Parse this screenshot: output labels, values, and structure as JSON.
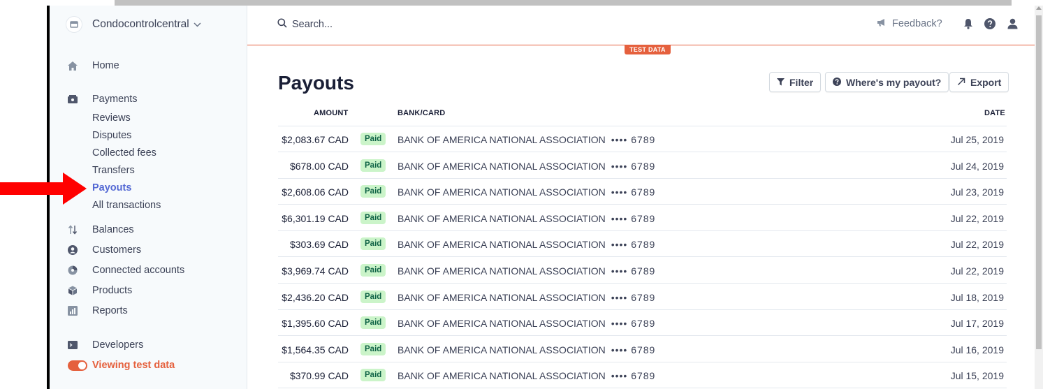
{
  "account": {
    "name": "Condocontrolcentral"
  },
  "search": {
    "placeholder": "Search..."
  },
  "topbar": {
    "feedback": "Feedback?"
  },
  "test_tag": "TEST DATA",
  "sidebar": {
    "home": "Home",
    "payments": "Payments",
    "payments_sub": [
      "Reviews",
      "Disputes",
      "Collected fees",
      "Transfers",
      "Payouts",
      "All transactions"
    ],
    "balances": "Balances",
    "customers": "Customers",
    "connected_accounts": "Connected accounts",
    "products": "Products",
    "reports": "Reports",
    "developers": "Developers",
    "viewing_test_data": "Viewing test data"
  },
  "page": {
    "title": "Payouts",
    "filter_label": "Filter",
    "wheres_payout_label": "Where's my payout?",
    "export_label": "Export"
  },
  "table": {
    "headers": {
      "amount": "AMOUNT",
      "bank": "BANK/CARD",
      "date": "DATE"
    },
    "rows": [
      {
        "amount": "$2,083.67",
        "currency": "CAD",
        "status": "Paid",
        "bank": "BANK OF AMERICA NATIONAL ASSOCIATION",
        "last4": "•••• 6789",
        "date": "Jul 25, 2019"
      },
      {
        "amount": "$678.00",
        "currency": "CAD",
        "status": "Paid",
        "bank": "BANK OF AMERICA NATIONAL ASSOCIATION",
        "last4": "•••• 6789",
        "date": "Jul 24, 2019"
      },
      {
        "amount": "$2,608.06",
        "currency": "CAD",
        "status": "Paid",
        "bank": "BANK OF AMERICA NATIONAL ASSOCIATION",
        "last4": "•••• 6789",
        "date": "Jul 23, 2019"
      },
      {
        "amount": "$6,301.19",
        "currency": "CAD",
        "status": "Paid",
        "bank": "BANK OF AMERICA NATIONAL ASSOCIATION",
        "last4": "•••• 6789",
        "date": "Jul 22, 2019"
      },
      {
        "amount": "$303.69",
        "currency": "CAD",
        "status": "Paid",
        "bank": "BANK OF AMERICA NATIONAL ASSOCIATION",
        "last4": "•••• 6789",
        "date": "Jul 22, 2019"
      },
      {
        "amount": "$3,969.74",
        "currency": "CAD",
        "status": "Paid",
        "bank": "BANK OF AMERICA NATIONAL ASSOCIATION",
        "last4": "•••• 6789",
        "date": "Jul 22, 2019"
      },
      {
        "amount": "$2,436.20",
        "currency": "CAD",
        "status": "Paid",
        "bank": "BANK OF AMERICA NATIONAL ASSOCIATION",
        "last4": "•••• 6789",
        "date": "Jul 18, 2019"
      },
      {
        "amount": "$1,395.60",
        "currency": "CAD",
        "status": "Paid",
        "bank": "BANK OF AMERICA NATIONAL ASSOCIATION",
        "last4": "•••• 6789",
        "date": "Jul 17, 2019"
      },
      {
        "amount": "$1,564.35",
        "currency": "CAD",
        "status": "Paid",
        "bank": "BANK OF AMERICA NATIONAL ASSOCIATION",
        "last4": "•••• 6789",
        "date": "Jul 16, 2019"
      },
      {
        "amount": "$370.99",
        "currency": "CAD",
        "status": "Paid",
        "bank": "BANK OF AMERICA NATIONAL ASSOCIATION",
        "last4": "•••• 6789",
        "date": "Jul 15, 2019"
      }
    ]
  },
  "colors": {
    "accent": "#5469d4",
    "test_mode": "#e5603d",
    "paid_bg": "#cbf4c9",
    "paid_text": "#0e6245",
    "annotation_arrow": "#ff0000"
  },
  "icons": [
    "account-logo-icon",
    "chevron-down-icon",
    "home-icon",
    "payments-icon",
    "balances-icon",
    "customers-icon",
    "connected-accounts-icon",
    "products-icon",
    "reports-icon",
    "developers-icon",
    "search-icon",
    "megaphone-icon",
    "bell-icon",
    "help-icon",
    "user-icon",
    "filter-icon",
    "question-circle-icon",
    "export-arrow-icon",
    "red-arrow-annotation"
  ]
}
